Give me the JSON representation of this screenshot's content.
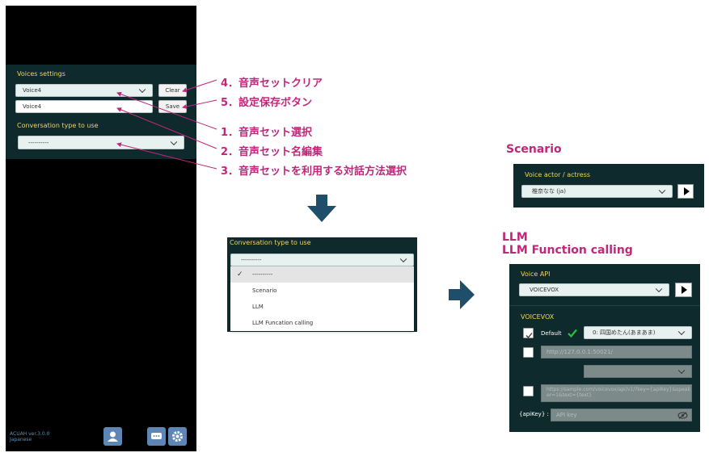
{
  "left_app": {
    "voices_settings_label": "Voices settings",
    "voice_select_value": "Voice4",
    "voice_name_value": "Voice4",
    "clear_button": "Clear",
    "save_button": "Save",
    "conv_type_label": "Conversation type to use",
    "conv_type_value": "----------",
    "version": "ACUAH ver.3.0.0",
    "language": "Japanese"
  },
  "annotations": {
    "a4": "4．音声セットクリア",
    "a5": "5．設定保存ボタン",
    "a1": "1．音声セット選択",
    "a2": "2．音声セット名編集",
    "a3": "3．音声セットを利用する対話方法選択"
  },
  "dropdown_example": {
    "label": "Conversation type to use",
    "value": "----------",
    "options": [
      "----------",
      "Scenario",
      "LLM",
      "LLM Funcation calling"
    ],
    "checkmark": "✓"
  },
  "scenario": {
    "heading": "Scenario",
    "voice_actor_label": "Voice actor / actress",
    "voice_actor_value": "椎奈なな (ja)"
  },
  "llm": {
    "heading1": "LLM",
    "heading2": "LLM Function calling",
    "voice_api_label": "Voice API",
    "voice_api_value": "VOICEVOX",
    "voicevox_label": "VOICEVOX",
    "default_label": "Default",
    "default_speaker": "0: 四国めたん(あまあま)",
    "url_placeholder": "http://127.0.0.1:50021/",
    "api_url_placeholder": "https://sample.com/voicevox/api/v1/?key={apiKey}&speaker=1&text={text}",
    "apikey_label": "{apiKey} :",
    "apikey_placeholder": "API key"
  },
  "colors": {
    "accent_label": "#f4d35e",
    "panel_bg": "#0e2a2c",
    "annotation": "#c0277a",
    "arrow": "#1f4e6b",
    "check_green": "#2bbf3f"
  }
}
